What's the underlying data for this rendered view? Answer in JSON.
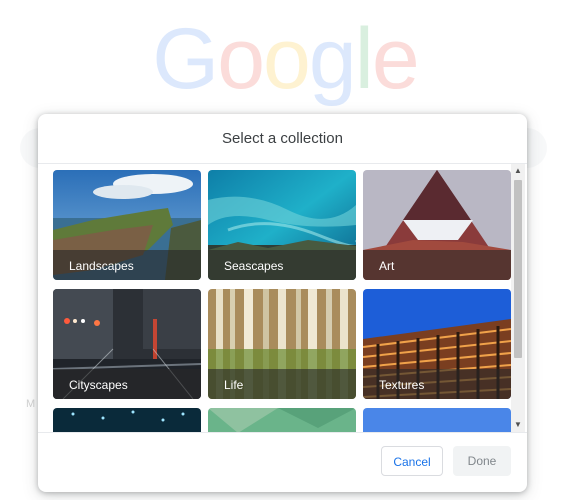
{
  "background": {
    "logo_text": "Google",
    "logo_colors": [
      "#4285F4",
      "#EA4335",
      "#FBBC05",
      "#4285F4",
      "#34A853",
      "#EA4335"
    ]
  },
  "dialog": {
    "title": "Select a collection",
    "cancel_label": "Cancel",
    "done_label": "Done",
    "collections": [
      {
        "label": "Landscapes"
      },
      {
        "label": "Seascapes"
      },
      {
        "label": "Art"
      },
      {
        "label": "Cityscapes"
      },
      {
        "label": "Life"
      },
      {
        "label": "Textures"
      },
      {
        "label": ""
      },
      {
        "label": ""
      },
      {
        "label": ""
      }
    ]
  },
  "colors": {
    "accent": "#1a73e8",
    "title_text": "#3c4043"
  }
}
